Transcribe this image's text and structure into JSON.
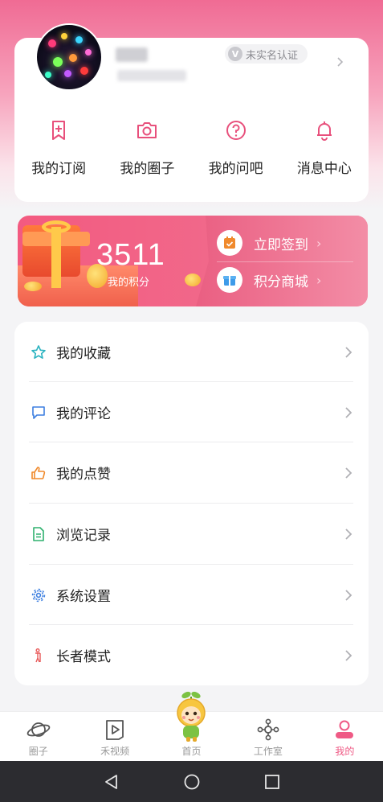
{
  "profile": {
    "verify_label": "未实名认证",
    "verify_icon_letter": "V"
  },
  "quick_links": [
    {
      "label": "我的订阅",
      "icon": "subscribe-icon"
    },
    {
      "label": "我的圈子",
      "icon": "camera-icon"
    },
    {
      "label": "我的问吧",
      "icon": "question-icon"
    },
    {
      "label": "消息中心",
      "icon": "bell-icon"
    }
  ],
  "points": {
    "value": "3511",
    "label": "我的积分",
    "checkin_label": "立即签到",
    "mall_label": "积分商城"
  },
  "menu": [
    {
      "label": "我的收藏",
      "icon": "star-icon",
      "color": "#2bb3c0"
    },
    {
      "label": "我的评论",
      "icon": "comment-icon",
      "color": "#3d7fe0"
    },
    {
      "label": "我的点赞",
      "icon": "thumbs-up-icon",
      "color": "#f08a2c"
    },
    {
      "label": "浏览记录",
      "icon": "document-icon",
      "color": "#2fb06e"
    },
    {
      "label": "系统设置",
      "icon": "gear-icon",
      "color": "#3d7fe0"
    },
    {
      "label": "长者模式",
      "icon": "elder-icon",
      "color": "#e85a5a"
    }
  ],
  "tabs": [
    {
      "label": "圈子",
      "icon": "planet-icon"
    },
    {
      "label": "禾视频",
      "icon": "video-play-icon"
    },
    {
      "label": "首页",
      "icon": "mascot-icon"
    },
    {
      "label": "工作室",
      "icon": "studio-icon"
    },
    {
      "label": "我的",
      "icon": "person-icon",
      "active": true
    }
  ],
  "colors": {
    "accent": "#ef5a85",
    "header_gradient_top": "#f06b94"
  }
}
